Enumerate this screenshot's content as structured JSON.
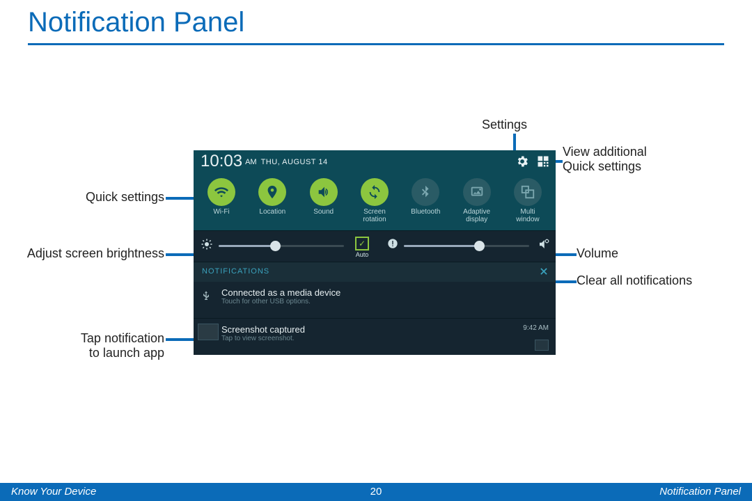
{
  "title": "Notification Panel",
  "footer": {
    "left": "Know Your Device",
    "center": "20",
    "right": "Notification Panel"
  },
  "callouts": {
    "settings": "Settings",
    "view_additional_line1": "View additional",
    "view_additional_line2": "Quick settings",
    "quick_settings": "Quick settings",
    "brightness": "Adjust screen brightness",
    "volume": "Volume",
    "clear": "Clear all notifications",
    "tap_line1": "Tap notification",
    "tap_line2": "to launch app"
  },
  "device": {
    "time": "10:03",
    "ampm": "AM",
    "date": "THU, AUGUST 14",
    "quick_settings": [
      {
        "label_l1": "Wi-Fi",
        "label_l2": "",
        "on": true,
        "icon": "wifi"
      },
      {
        "label_l1": "Location",
        "label_l2": "",
        "on": true,
        "icon": "location"
      },
      {
        "label_l1": "Sound",
        "label_l2": "",
        "on": true,
        "icon": "sound"
      },
      {
        "label_l1": "Screen",
        "label_l2": "rotation",
        "on": true,
        "icon": "rotation"
      },
      {
        "label_l1": "Bluetooth",
        "label_l2": "",
        "on": false,
        "icon": "bluetooth"
      },
      {
        "label_l1": "Adaptive",
        "label_l2": "display",
        "on": false,
        "icon": "adaptive"
      },
      {
        "label_l1": "Multi",
        "label_l2": "window",
        "on": false,
        "icon": "multiwindow"
      }
    ],
    "brightness_pct": 45,
    "volume_pct": 60,
    "auto_label": "Auto",
    "auto_checked": true,
    "notifications_header": "NOTIFICATIONS",
    "notifications": [
      {
        "title": "Connected as a media device",
        "subtitle": "Touch for other USB options.",
        "icon": "usb",
        "time": "",
        "thumb": false
      },
      {
        "title": "Screenshot captured",
        "subtitle": "Tap to view screenshot.",
        "icon": "shot",
        "time": "9:42 AM",
        "thumb": true
      }
    ]
  }
}
